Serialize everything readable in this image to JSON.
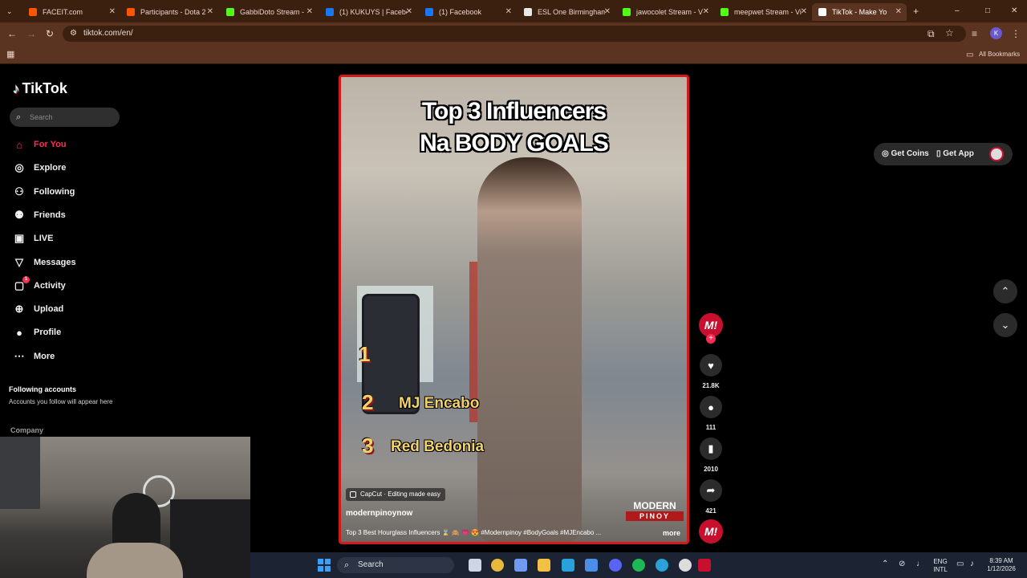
{
  "browser": {
    "tabs": [
      {
        "label": "FACEIT.com",
        "color": "#ff5500"
      },
      {
        "label": "Participants - Dota 2",
        "color": "#ff5500"
      },
      {
        "label": "GabbiDoto Stream -",
        "color": "#53fc18"
      },
      {
        "label": "(1) KUKUYS | Facebo",
        "color": "#1877f2"
      },
      {
        "label": "(1) Facebook",
        "color": "#1877f2"
      },
      {
        "label": "ESL One Birmingham",
        "color": "#e8e8e8"
      },
      {
        "label": "jawocolet Stream - V",
        "color": "#53fc18"
      },
      {
        "label": "meepwet Stream - Vi",
        "color": "#53fc18"
      },
      {
        "label": "TikTok - Make Yo",
        "color": "#ffffff"
      }
    ],
    "url": "tiktok.com/en/",
    "bookmarks_label": "All Bookmarks"
  },
  "tiktok": {
    "logo": "TikTok",
    "search_placeholder": "Search",
    "nav": [
      {
        "label": "For You",
        "icon": "home-icon"
      },
      {
        "label": "Explore",
        "icon": "compass-icon"
      },
      {
        "label": "Following",
        "icon": "user-follow-icon"
      },
      {
        "label": "Friends",
        "icon": "friends-icon"
      },
      {
        "label": "LIVE",
        "icon": "live-icon"
      },
      {
        "label": "Messages",
        "icon": "message-icon"
      },
      {
        "label": "Activity",
        "icon": "activity-icon"
      },
      {
        "label": "Upload",
        "icon": "upload-icon"
      },
      {
        "label": "Profile",
        "icon": "profile-icon"
      },
      {
        "label": "More",
        "icon": "more-icon"
      }
    ],
    "activity_badge": "1",
    "following_title": "Following accounts",
    "following_sub": "Accounts you follow will appear here",
    "company": "Company",
    "get_coins": "Get Coins",
    "get_app": "Get App"
  },
  "video": {
    "title_line1": "Top 3 Influencers",
    "title_line2": "Na BODY GOALS",
    "ranks": [
      {
        "num": "1",
        "name": ""
      },
      {
        "num": "2",
        "name": "MJ Encabo"
      },
      {
        "num": "3",
        "name": "Red Bedonia"
      }
    ],
    "capcut": "CapCut · Editing made easy",
    "username": "modernpinoynow",
    "description": "Top 3 Best Hourglass Influencers ⌛ 🙈 💗 😍 #Modernpinoy #BodyGoals #MJEncabo ...",
    "more": "more",
    "brand_top": "MODERN",
    "brand_bottom": "PINOY",
    "avatar_text": "M!",
    "likes": "21.8K",
    "comments": "111",
    "saves": "2010",
    "shares": "421"
  },
  "taskbar": {
    "search": "Search",
    "lang1": "ENG",
    "lang2": "INTL",
    "time": "8:39 AM",
    "date": "1/12/2026"
  }
}
